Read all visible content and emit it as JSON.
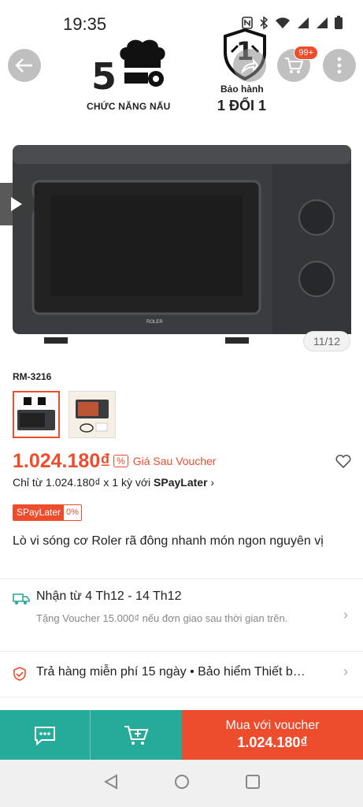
{
  "status_bar": {
    "time": "19:35"
  },
  "hero": {
    "banner_number": "5",
    "banner_label": "CHỨC NĂNG NẤU",
    "warranty_number": "1",
    "warranty_sub": "Bảo hành",
    "warranty_main": "1 ĐỔI 1",
    "cart_badge": "99+",
    "brand_text": "ROLER",
    "image_counter": "11/12"
  },
  "variant": {
    "name": "RM-3216"
  },
  "price": {
    "value": "1.024.180₫",
    "voucher_label": "Giá Sau Voucher",
    "installment_prefix": "Chỉ từ 1.024.180₫ x 1 kỳ với ",
    "installment_brand": "SPayLater",
    "badge_left": "SPayLater",
    "badge_right": "0%"
  },
  "product": {
    "title": "Lò vi sóng cơ Roler rã đông nhanh món ngon nguyên vị"
  },
  "shipping": {
    "title": "Nhận từ 4 Th12 - 14 Th12",
    "subtitle": "Tặng Voucher 15.000₫ nếu đơn giao sau thời gian trên."
  },
  "returns": {
    "text": "Trả hàng miễn phí 15 ngày • Bảo hiểm Thiết b…"
  },
  "actions": {
    "buy_label": "Mua với voucher",
    "buy_price": "1.024.180₫"
  },
  "colors": {
    "accent": "#ee4d2d",
    "teal": "#26aa99"
  }
}
